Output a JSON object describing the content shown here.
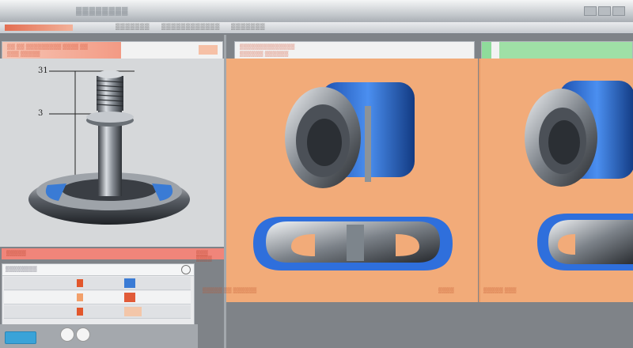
{
  "window": {
    "title": "▓▓▓▓▓▓▓▓"
  },
  "menu": {
    "items": [
      "▒▒▒▒▒▒▒",
      "▒▒▒▒▒▒▒▒▒▒▒▒",
      "▒▒▒▒▒▒▒"
    ]
  },
  "panels": {
    "left": {
      "header": "▒▒ ▒▒ ▒▒▒▒▒▒▒▒▒ ▒▒▒▒ ▒▒",
      "sub": "▒▒▒ ▒▒▒▒▒",
      "footer_left": "▒▒▒▒▒",
      "footer_right": "▒▒▒ ▒▒▒▒"
    },
    "middle": {
      "header": "▒▒▒▒▒▒▒▒▒▒▒▒▒▒",
      "sub": "▒▒▒▒▒▒ ▒▒▒▒▒▒",
      "caption": "▒▒▒▒▒ ▒▒ ▒▒▒▒▒▒",
      "caption_right": "▒▒▒▒"
    },
    "right": {
      "caption": "▒▒▒▒▒ ▒▒▒"
    }
  },
  "dimensions": {
    "top_marker": "31",
    "mid_marker": "3"
  },
  "list": {
    "header": "▒▒▒▒▒▒▒▒",
    "rows": 4
  },
  "colors": {
    "accent_orange": "#f2ab79",
    "accent_red": "#f0857a",
    "accent_green": "#7fd18b",
    "accent_blue": "#3aa3d8"
  },
  "icons": [
    "help-icon",
    "settings-icon"
  ]
}
